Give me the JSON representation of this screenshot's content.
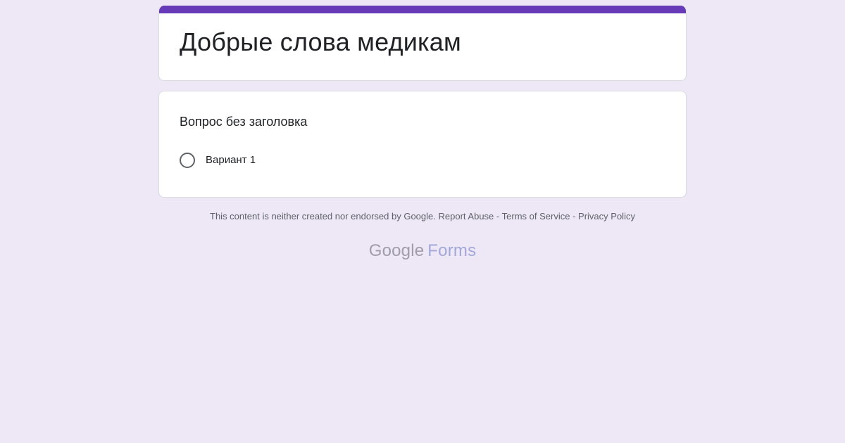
{
  "form": {
    "title": "Добрые слова медикам",
    "accent_color": "#673ab7",
    "background_color": "#ede7f6"
  },
  "question": {
    "title": "Вопрос без заголовка",
    "options": [
      {
        "label": "Вариант 1"
      }
    ]
  },
  "footer": {
    "disclaimer": "This content is neither created nor endorsed by Google.",
    "report_abuse": "Report Abuse",
    "separator": "-",
    "terms": "Terms of Service",
    "privacy": "Privacy Policy"
  },
  "brand": {
    "google": "Google",
    "forms": "Forms"
  }
}
